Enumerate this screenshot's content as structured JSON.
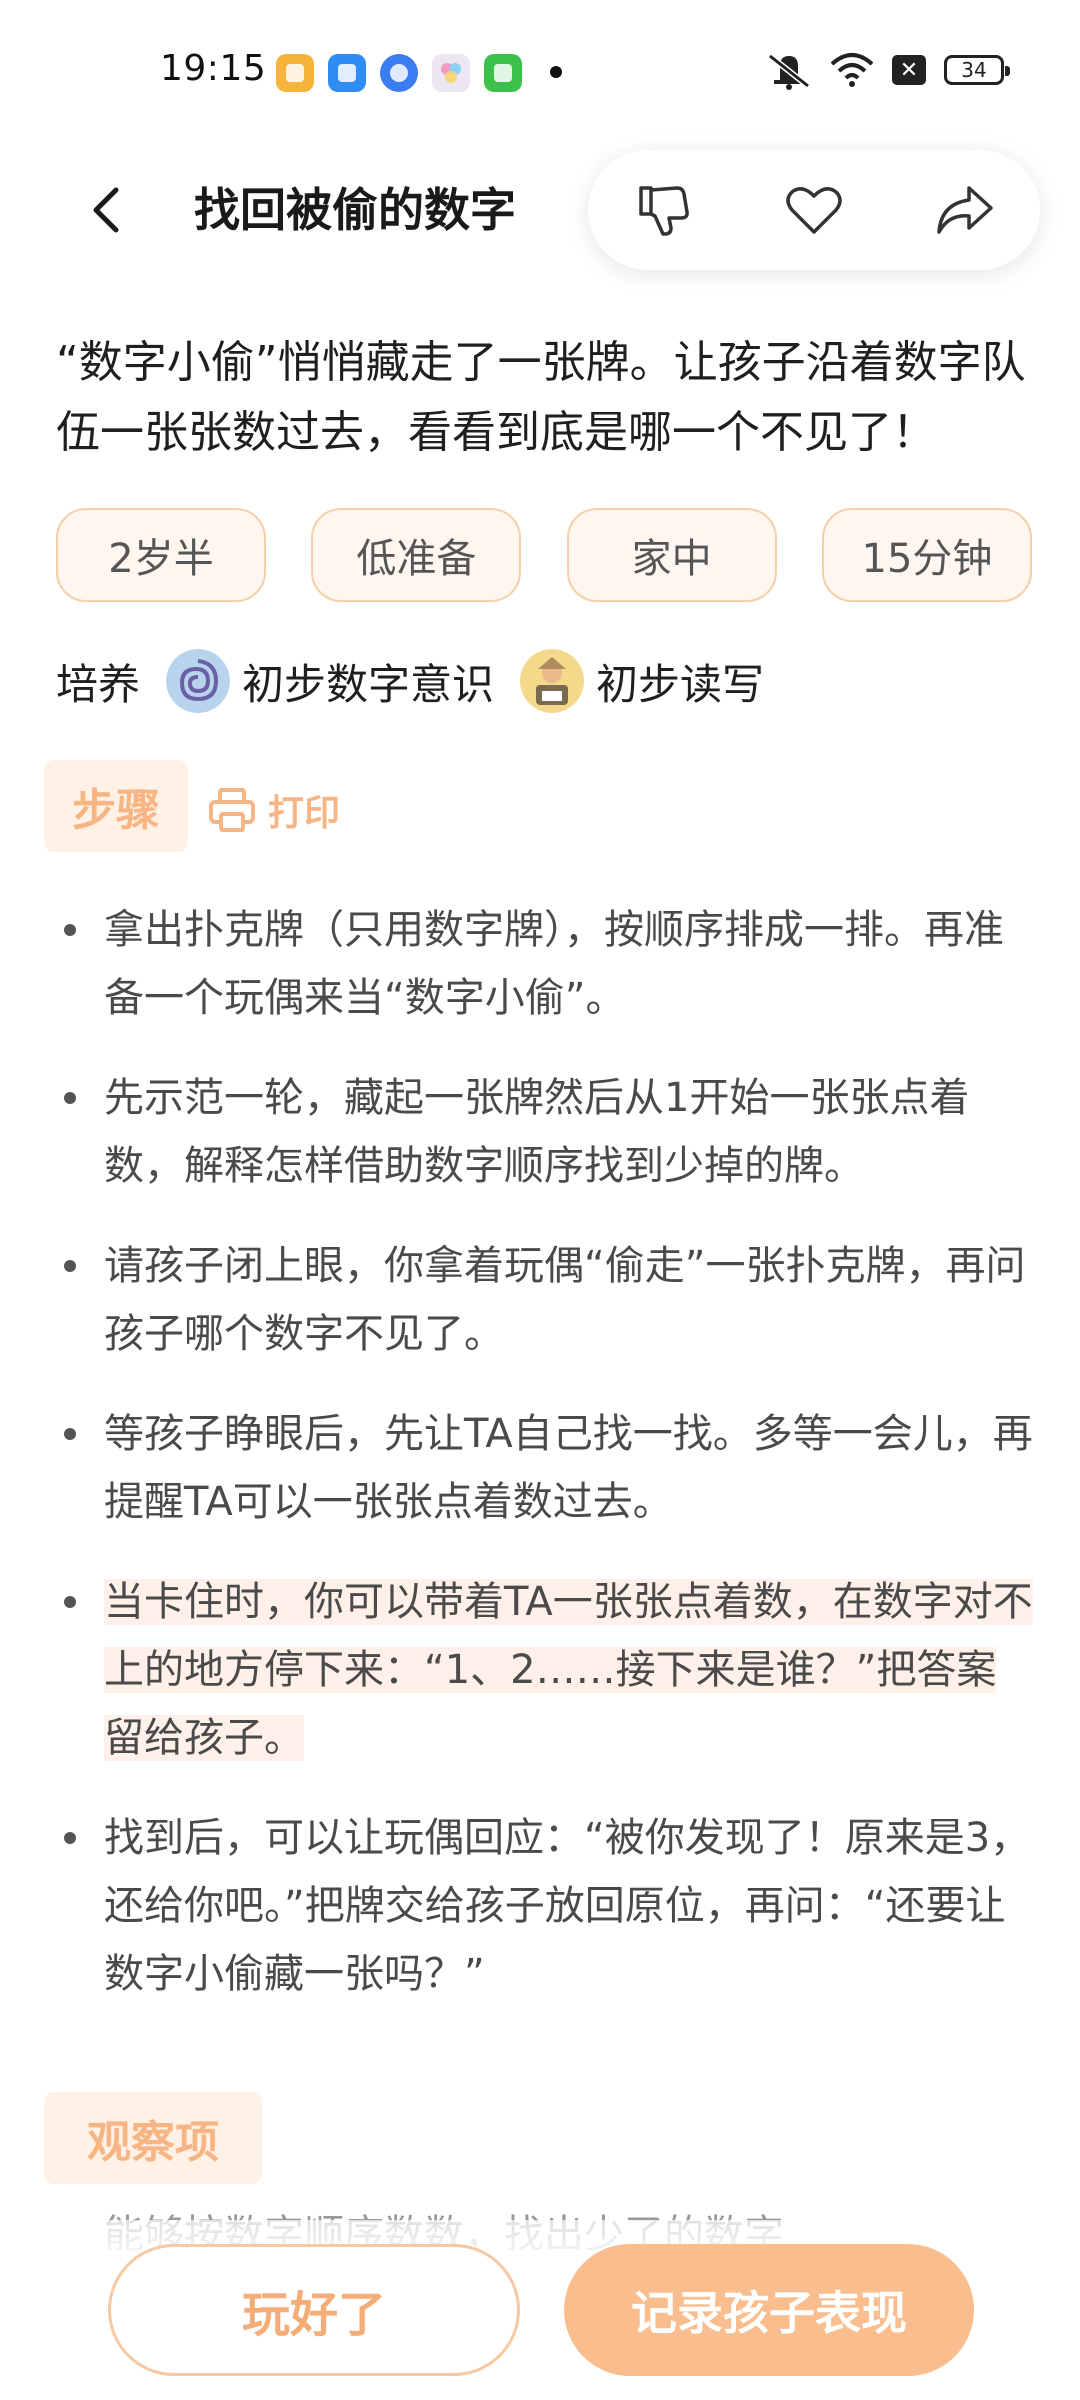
{
  "status_bar": {
    "time": "19:15",
    "battery": "34",
    "app_icons": [
      {
        "name": "books-app-icon",
        "color": "#f6b53a"
      },
      {
        "name": "files-app-icon",
        "color": "#2f8cf5"
      },
      {
        "name": "browser-app-icon",
        "color": "#3b7cf0"
      },
      {
        "name": "gallery-app-icon",
        "color": "#e8e4f0"
      },
      {
        "name": "wechat-app-icon",
        "color": "#3cc24a"
      }
    ]
  },
  "header": {
    "title": "找回被偷的数字",
    "actions": [
      "dislike-icon",
      "heart-icon",
      "share-icon"
    ]
  },
  "description": "“数字小偷”悄悄藏走了一张牌。让孩子沿着数字队伍一张张数过去，看看到底是哪一个不见了！",
  "tags": [
    "2岁半",
    "低准备",
    "家中",
    "15分钟"
  ],
  "skills": {
    "label": "培养",
    "items": [
      "初步数字意识",
      "初步读写"
    ]
  },
  "steps_section": {
    "heading": "步骤",
    "print_label": "打印",
    "items": [
      "拿出扑克牌（只用数字牌），按顺序排成一排。再准备一个玩偶来当“数字小偷”。",
      "先示范一轮，藏起一张牌然后从1开始一张张点着数，解释怎样借助数字顺序找到少掉的牌。",
      "请孩子闭上眼，你拿着玩偶“偷走”一张扑克牌，再问孩子哪个数字不见了。",
      "等孩子睁眼后，先让TA自己找一找。多等一会儿，再提醒TA可以一张张点着数过去。",
      "当卡住时，你可以带着TA一张张点着数，在数字对不上的地方停下来：“1、2……接下来是谁？”把答案留给孩子。",
      "找到后，可以让玩偶回应：“被你发现了！原来是3，还给你吧。”把牌交给孩子放回原位，再问：“还要让数字小偷藏一张吗？”"
    ]
  },
  "observation_section": {
    "heading": "观察项",
    "partial_text": "能够按数字顺序数数，找出少了的数字"
  },
  "buttons": {
    "done": "玩好了",
    "record": "记录孩子表现"
  },
  "colors": {
    "accent": "#f9bd8e",
    "accent_text": "#f5ad78",
    "tag_border": "#f6cfa8",
    "tag_bg": "#fff7ef",
    "heading_bg": "#fff1e6",
    "highlight": "#fff1e9"
  }
}
